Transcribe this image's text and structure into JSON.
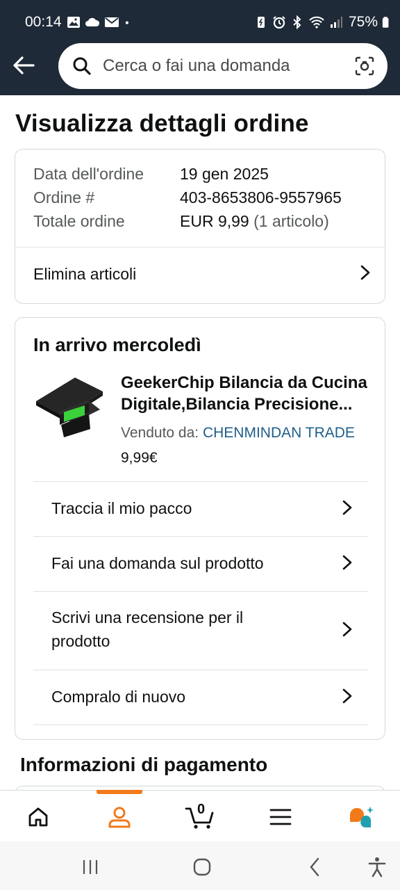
{
  "status_bar": {
    "time": "00:14",
    "battery": "75%",
    "left_icons": [
      "image-icon",
      "cloud-icon",
      "mail-icon",
      "dot-icon"
    ],
    "right_icons": [
      "battery-saver-icon",
      "alarm-icon",
      "bluetooth-icon",
      "wifi-icon",
      "signal-icon",
      "battery-icon"
    ]
  },
  "header": {
    "search_placeholder": "Cerca o fai una domanda"
  },
  "page_title": "Visualizza dettagli ordine",
  "order_summary": {
    "rows": [
      {
        "label": "Data dell'ordine",
        "value": "19 gen 2025"
      },
      {
        "label": "Ordine #",
        "value": "403-8653806-9557965"
      },
      {
        "label": "Totale ordine",
        "value": "EUR 9,99",
        "extra": "(1 articolo)"
      }
    ],
    "delete_items_label": "Elimina articoli"
  },
  "shipment": {
    "title": "In arrivo mercoledì",
    "product": {
      "title_line1": "GeekerChip Bilancia da Cucina",
      "title_line2": "Digitale,Bilancia Precisione...",
      "sold_by_label": "Venduto da:",
      "seller": "CHENMINDAN TRADE",
      "price": "9,99€"
    },
    "actions": [
      {
        "label": "Traccia il mio pacco"
      },
      {
        "label": "Fai una domanda sul prodotto"
      },
      {
        "label": "Scrivi una recensione per il",
        "label2": "prodotto"
      },
      {
        "label": "Compralo di nuovo"
      }
    ]
  },
  "payment_section_title": "Informazioni di pagamento",
  "bottom_nav": {
    "cart_count": "0",
    "accent": "#f27a1a"
  },
  "colors": {
    "header_bg": "#1f2a38",
    "seller_link": "#1f5e8a"
  }
}
